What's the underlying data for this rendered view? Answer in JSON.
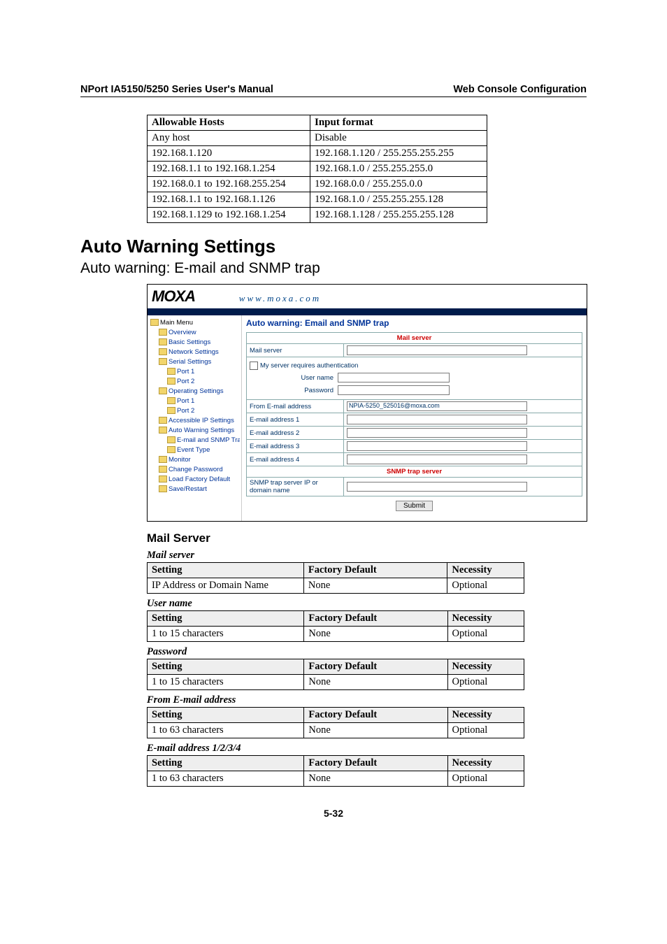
{
  "header": {
    "left": "NPort IA5150/5250 Series User's Manual",
    "right": "Web Console Configuration"
  },
  "allowable_table": {
    "head": [
      "Allowable Hosts",
      "Input format"
    ],
    "rows": [
      [
        "Any host",
        "Disable"
      ],
      [
        "192.168.1.120",
        "192.168.1.120 / 255.255.255.255"
      ],
      [
        "192.168.1.1 to 192.168.1.254",
        "192.168.1.0 / 255.255.255.0"
      ],
      [
        "192.168.0.1 to 192.168.255.254",
        "192.168.0.0 / 255.255.0.0"
      ],
      [
        "192.168.1.1 to 192.168.1.126",
        "192.168.1.0 / 255.255.255.128"
      ],
      [
        "192.168.1.129 to 192.168.1.254",
        "192.168.1.128 / 255.255.255.128"
      ]
    ]
  },
  "section_title": "Auto Warning Settings",
  "subsection_title": "Auto warning: E-mail and SNMP trap",
  "screenshot": {
    "logo": "MOXA",
    "url": "www.moxa.com",
    "nav": {
      "root": "Main Menu",
      "items": [
        {
          "l": "Overview",
          "d": 1
        },
        {
          "l": "Basic Settings",
          "d": 1
        },
        {
          "l": "Network Settings",
          "d": 1
        },
        {
          "l": "Serial Settings",
          "d": 1,
          "open": true
        },
        {
          "l": "Port 1",
          "d": 2
        },
        {
          "l": "Port 2",
          "d": 2
        },
        {
          "l": "Operating Settings",
          "d": 1,
          "open": true
        },
        {
          "l": "Port 1",
          "d": 2
        },
        {
          "l": "Port 2",
          "d": 2
        },
        {
          "l": "Accessible IP Settings",
          "d": 1
        },
        {
          "l": "Auto Warning Settings",
          "d": 1,
          "open": true
        },
        {
          "l": "E-mail and SNMP Trap",
          "d": 2
        },
        {
          "l": "Event Type",
          "d": 2
        },
        {
          "l": "Monitor",
          "d": 1
        },
        {
          "l": "Change Password",
          "d": 1
        },
        {
          "l": "Load Factory Default",
          "d": 1
        },
        {
          "l": "Save/Restart",
          "d": 1
        }
      ]
    },
    "panel": {
      "title": "Auto warning: Email and SNMP trap",
      "mail_server_heading": "Mail server",
      "mail_server_label": "Mail server",
      "auth_checkbox": "My server requires authentication",
      "user_name": "User name",
      "password": "Password",
      "from_email": "From E-mail address",
      "from_email_value": "NPIA-5250_525016@moxa.com",
      "email1": "E-mail address 1",
      "email2": "E-mail address 2",
      "email3": "E-mail address 3",
      "email4": "E-mail address 4",
      "snmp_heading": "SNMP trap server",
      "snmp_label": "SNMP trap server IP or domain name",
      "submit": "Submit"
    }
  },
  "mail_server_heading": "Mail Server",
  "settings_tables": [
    {
      "title": "Mail server",
      "head": [
        "Setting",
        "Factory Default",
        "Necessity"
      ],
      "row": [
        "IP Address or Domain Name",
        "None",
        "Optional"
      ]
    },
    {
      "title": "User name",
      "head": [
        "Setting",
        "Factory Default",
        "Necessity"
      ],
      "row": [
        "1 to 15 characters",
        "None",
        "Optional"
      ]
    },
    {
      "title": "Password",
      "head": [
        "Setting",
        "Factory Default",
        "Necessity"
      ],
      "row": [
        "1 to 15 characters",
        "None",
        "Optional"
      ]
    },
    {
      "title": "From E-mail address",
      "head": [
        "Setting",
        "Factory Default",
        "Necessity"
      ],
      "row": [
        "1 to 63 characters",
        "None",
        "Optional"
      ]
    },
    {
      "title": "E-mail address 1/2/3/4",
      "head": [
        "Setting",
        "Factory Default",
        "Necessity"
      ],
      "row": [
        "1 to 63 characters",
        "None",
        "Optional"
      ]
    }
  ],
  "footer": "5-32"
}
